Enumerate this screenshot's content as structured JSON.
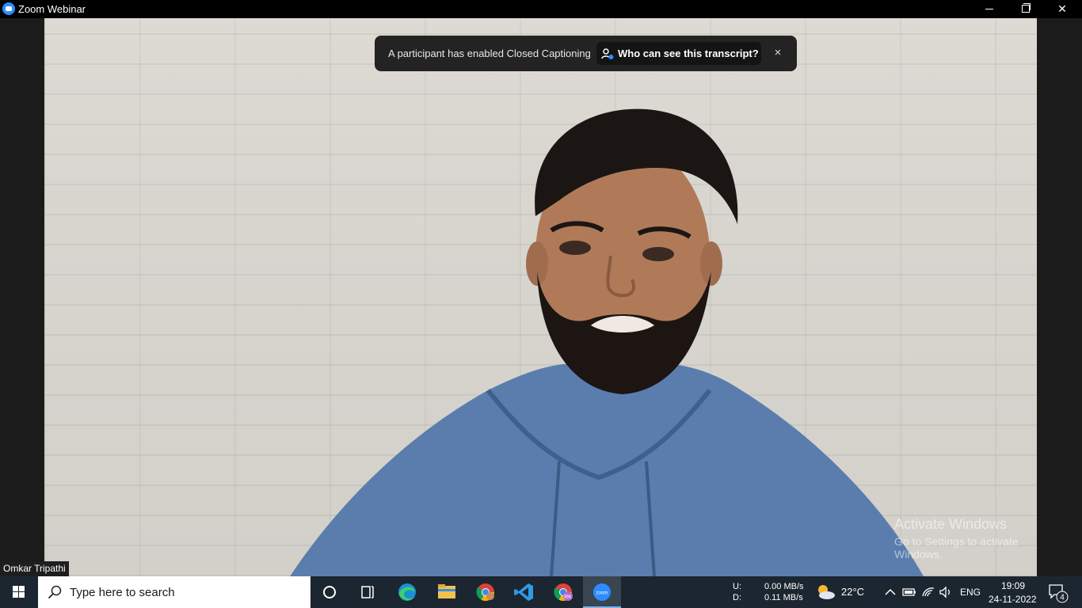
{
  "window": {
    "title": "Zoom Webinar"
  },
  "caption_banner": {
    "message": "A participant has enabled Closed Captioning",
    "button_label": "Who can see this transcript?",
    "close_symbol": "×"
  },
  "participant": {
    "name": "Omkar Tripathi"
  },
  "watermark": {
    "title": "Activate Windows",
    "subtitle": "Go to Settings to activate Windows."
  },
  "taskbar": {
    "search_placeholder": "Type here to search",
    "network": {
      "upload_label": "U:",
      "download_label": "D:",
      "upload_rate": "0.00 MB/s",
      "download_rate": "0.11 MB/s"
    },
    "weather": {
      "temperature": "22°C"
    },
    "language": "ENG",
    "time": "19:09",
    "date": "24-11-2022",
    "notification_count": "4",
    "zoom_app_label": "zoom",
    "chrome_profile_badge": "RK"
  },
  "colors": {
    "zoom_blue": "#2d8cff",
    "taskbar_bg": "#1c2630",
    "banner_bg": "#232323"
  }
}
